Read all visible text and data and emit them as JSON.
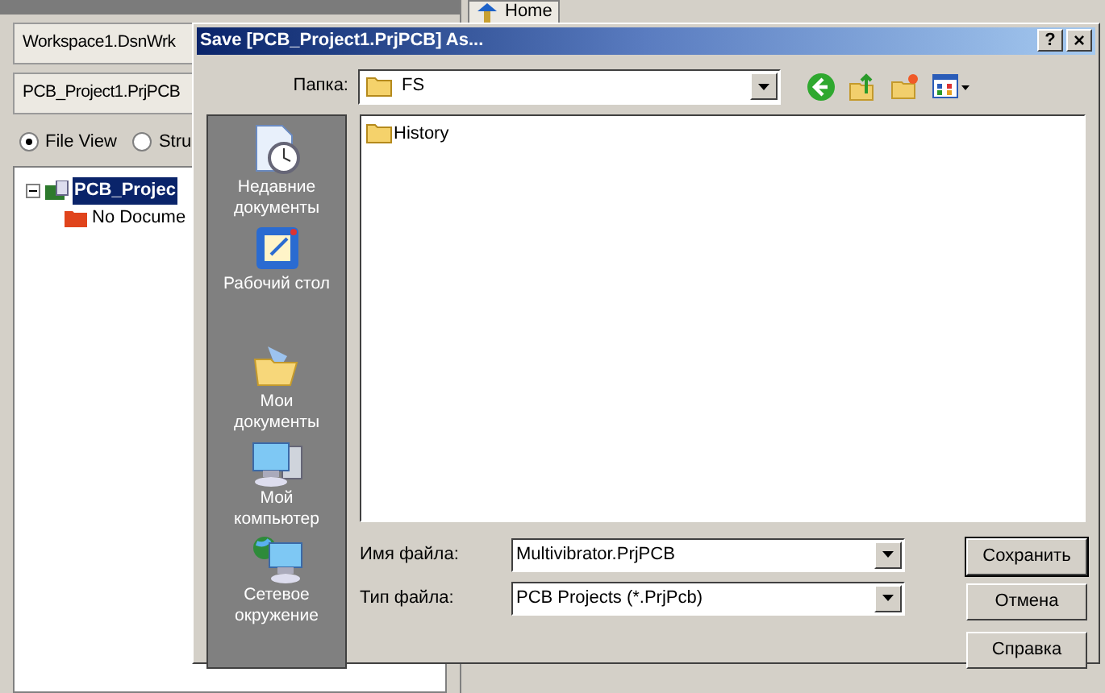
{
  "background": {
    "workspace_field": "Workspace1.DsnWrk",
    "project_field": "PCB_Project1.PrjPCB",
    "view_options": [
      {
        "label": "File View",
        "selected": true
      },
      {
        "label": "Stru",
        "selected": false
      }
    ],
    "tree": [
      {
        "label": "PCB_Projec",
        "selected": true,
        "expanded": true,
        "children": [
          {
            "label": "No Docume",
            "selected": false
          }
        ]
      }
    ],
    "tabs": [
      {
        "label": "Home",
        "selected": true
      }
    ]
  },
  "dialog": {
    "title": "Save [PCB_Project1.PrjPCB] As...",
    "help_button": "?",
    "close_button": "×",
    "folder_label": "Папка:",
    "folder_value": "FS",
    "places": [
      {
        "label": "Недавние документы",
        "kind": "recent"
      },
      {
        "label": "Рабочий стол",
        "kind": "desktop"
      },
      {
        "label": "Мои документы",
        "kind": "documents"
      },
      {
        "label": "Мой компьютер",
        "kind": "computer"
      },
      {
        "label": "Сетевое окружение",
        "kind": "network"
      }
    ],
    "files": [
      {
        "name": "History",
        "selected": false
      }
    ],
    "filename_label": "Имя файла:",
    "filename_value": "Multivibrator.PrjPCB",
    "filetype_label": "Тип файла:",
    "filetype_value": "PCB Projects (*.PrjPcb)",
    "buttons": [
      {
        "label": "Сохранить",
        "default": true
      },
      {
        "label": "Отмена",
        "default": false
      },
      {
        "label": "Справка",
        "default": false
      }
    ]
  }
}
